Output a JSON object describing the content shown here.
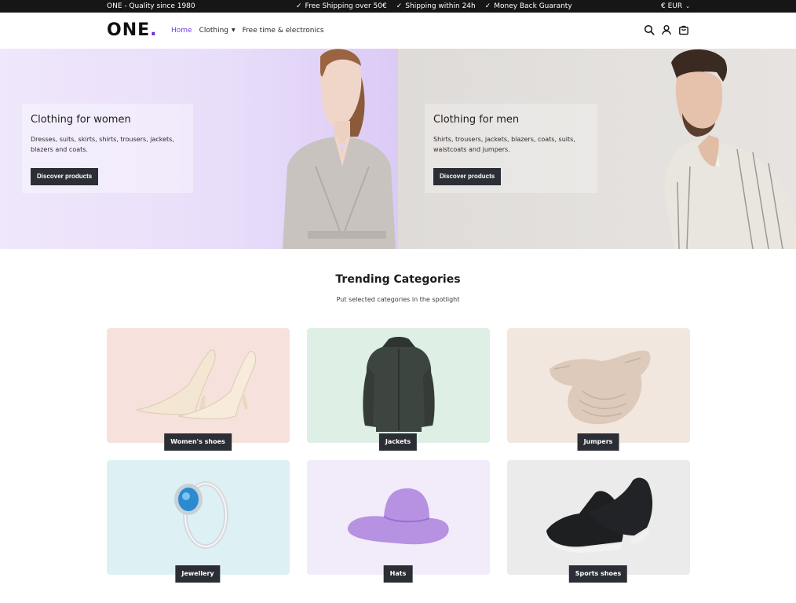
{
  "topbar": {
    "brandline": "ONE - Quality since 1980",
    "usps": [
      "Free Shipping over 50€",
      "Shipping within 24h",
      "Money Back Guaranty"
    ],
    "currency": "€ EUR"
  },
  "header": {
    "logo": "ONE",
    "nav": [
      {
        "label": "Home"
      },
      {
        "label": "Clothing"
      },
      {
        "label": "Free time & electronics"
      }
    ]
  },
  "hero": {
    "women": {
      "title": "Clothing for women",
      "text": "Dresses, suits, skirts, shirts, trousers, jackets, blazers and coats.",
      "button": "Discover products"
    },
    "men": {
      "title": "Clothing for men",
      "text": "Shirts, trousers, jackets, blazers, coats, suits, waistcoats and jumpers.",
      "button": "Discover products"
    }
  },
  "trending": {
    "title": "Trending Categories",
    "subtitle": "Put selected categories in the spotlight",
    "categories": [
      {
        "label": "Women's shoes",
        "bg": "#f6e1dc"
      },
      {
        "label": "Jackets",
        "bg": "#deefe5"
      },
      {
        "label": "Jumpers",
        "bg": "#f2e7df"
      },
      {
        "label": "Jewellery",
        "bg": "#ddf0f4"
      },
      {
        "label": "Hats",
        "bg": "#f1ebfa"
      },
      {
        "label": "Sports shoes",
        "bg": "#ebebeb"
      }
    ]
  },
  "colors": {
    "accent": "#7a3ee8",
    "dark_button": "#2b2f35"
  }
}
